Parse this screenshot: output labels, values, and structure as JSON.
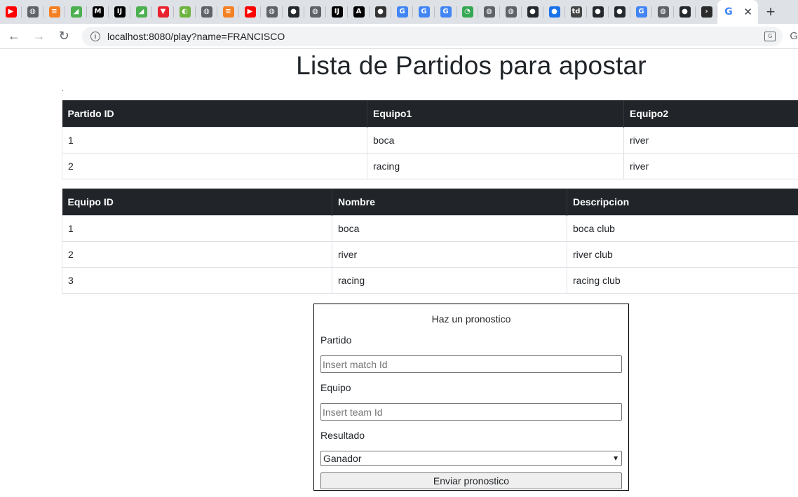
{
  "browser": {
    "tabs": [
      {
        "icon": "youtube-icon",
        "color": "#ff0000",
        "glyph": "▶"
      },
      {
        "icon": "globe-icon",
        "color": "#5f6368",
        "glyph": "◍"
      },
      {
        "icon": "stackoverflow-icon",
        "color": "#f48024",
        "glyph": "≡"
      },
      {
        "icon": "leaf-icon",
        "color": "#4caf50",
        "glyph": "◢"
      },
      {
        "icon": "medium-icon",
        "color": "#000000",
        "glyph": "M"
      },
      {
        "icon": "intellij-icon",
        "color": "#000000",
        "glyph": "IJ"
      },
      {
        "icon": "leaf-icon",
        "color": "#4caf50",
        "glyph": "◢"
      },
      {
        "icon": "vue-icon",
        "color": "#e8222e",
        "glyph": "▼"
      },
      {
        "icon": "spring-icon",
        "color": "#6db33f",
        "glyph": "◐"
      },
      {
        "icon": "globe-icon",
        "color": "#5f6368",
        "glyph": "◍"
      },
      {
        "icon": "stackoverflow-icon",
        "color": "#f48024",
        "glyph": "≡"
      },
      {
        "icon": "youtube-icon",
        "color": "#ff0000",
        "glyph": "▶"
      },
      {
        "icon": "globe-icon",
        "color": "#5f6368",
        "glyph": "◍"
      },
      {
        "icon": "github-icon",
        "color": "#24292e",
        "glyph": "●"
      },
      {
        "icon": "globe-icon",
        "color": "#5f6368",
        "glyph": "◍"
      },
      {
        "icon": "intellij-icon",
        "color": "#000000",
        "glyph": "IJ"
      },
      {
        "icon": "ide-icon",
        "color": "#000000",
        "glyph": "A"
      },
      {
        "icon": "badge-icon",
        "color": "#333333",
        "glyph": "●"
      },
      {
        "icon": "google-icon",
        "color": "#4285f4",
        "glyph": "G"
      },
      {
        "icon": "google-icon",
        "color": "#4285f4",
        "glyph": "G"
      },
      {
        "icon": "google-icon",
        "color": "#4285f4",
        "glyph": "G"
      },
      {
        "icon": "drive-icon",
        "color": "#34a853",
        "glyph": "◔"
      },
      {
        "icon": "globe-icon",
        "color": "#5f6368",
        "glyph": "◍"
      },
      {
        "icon": "globe-icon",
        "color": "#5f6368",
        "glyph": "◍"
      },
      {
        "icon": "github-icon",
        "color": "#24292e",
        "glyph": "●"
      },
      {
        "icon": "blue-circle-icon",
        "color": "#1a73e8",
        "glyph": "●"
      },
      {
        "icon": "td-icon",
        "color": "#444444",
        "glyph": "td"
      },
      {
        "icon": "github-icon",
        "color": "#24292e",
        "glyph": "●"
      },
      {
        "icon": "github-icon",
        "color": "#24292e",
        "glyph": "●"
      },
      {
        "icon": "google-icon",
        "color": "#4285f4",
        "glyph": "G"
      },
      {
        "icon": "globe-icon",
        "color": "#5f6368",
        "glyph": "◍"
      },
      {
        "icon": "github-icon",
        "color": "#24292e",
        "glyph": "●"
      },
      {
        "icon": "terminal-icon",
        "color": "#2b2b2b",
        "glyph": "›"
      }
    ],
    "active_tab": {
      "icon": "google-icon",
      "color": "#4285f4",
      "glyph": "G",
      "close": "✕"
    },
    "new_tab": "+",
    "url": "localhost:8080/play?name=FRANCISCO"
  },
  "page": {
    "title": "Lista de Partidos para apostar",
    "dot": ".",
    "matches": {
      "headers": [
        "Partido ID",
        "Equipo1",
        "Equipo2"
      ],
      "rows": [
        [
          "1",
          "boca",
          "river"
        ],
        [
          "2",
          "racing",
          "river"
        ]
      ]
    },
    "teams": {
      "headers": [
        "Equipo ID",
        "Nombre",
        "Descripcion"
      ],
      "rows": [
        [
          "1",
          "boca",
          "boca club"
        ],
        [
          "2",
          "river",
          "river club"
        ],
        [
          "3",
          "racing",
          "racing club"
        ]
      ]
    },
    "form": {
      "title": "Haz un pronostico",
      "match_label": "Partido",
      "match_placeholder": "Insert match Id",
      "team_label": "Equipo",
      "team_placeholder": "Insert team Id",
      "result_label": "Resultado",
      "result_value": "Ganador",
      "submit_label": "Enviar pronostico"
    }
  }
}
